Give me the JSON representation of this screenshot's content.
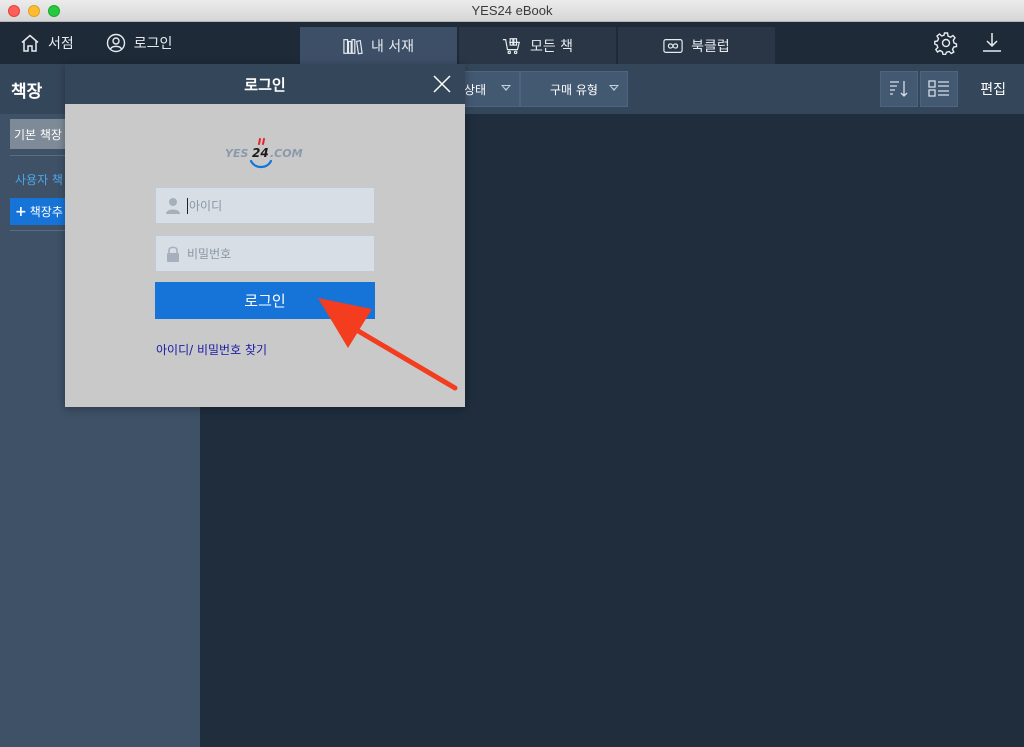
{
  "window": {
    "title": "YES24 eBook"
  },
  "nav": {
    "store_label": "서점",
    "login_label": "로그인",
    "tabs": [
      {
        "label": "내 서재",
        "icon": "bookshelf-icon",
        "active": true
      },
      {
        "label": "모든 책",
        "icon": "cart-books-icon",
        "active": false
      },
      {
        "label": "북클럽",
        "icon": "infinity-book-icon",
        "active": false
      }
    ]
  },
  "sidebar": {
    "title": "책장",
    "default_shelf": "기본 책장",
    "user_shelf": "사용자 책",
    "add_shelf_plus": "+",
    "add_shelf": "책장추"
  },
  "toolbar": {
    "status_filter": "상태",
    "purchase_filter": "구매 유형",
    "edit": "편집"
  },
  "dialog": {
    "title": "로그인",
    "logo_text_left": "YES",
    "logo_text_num": "24",
    "logo_text_right": ".COM",
    "id_placeholder": "아이디",
    "password_placeholder": "비밀번호",
    "login_button": "로그인",
    "find_link": "아이디/ 비밀번호 찾기"
  },
  "colors": {
    "brand_blue": "#1673d8",
    "nav_bg": "#1e2a38",
    "annotation_arrow": "#f43c1e"
  }
}
